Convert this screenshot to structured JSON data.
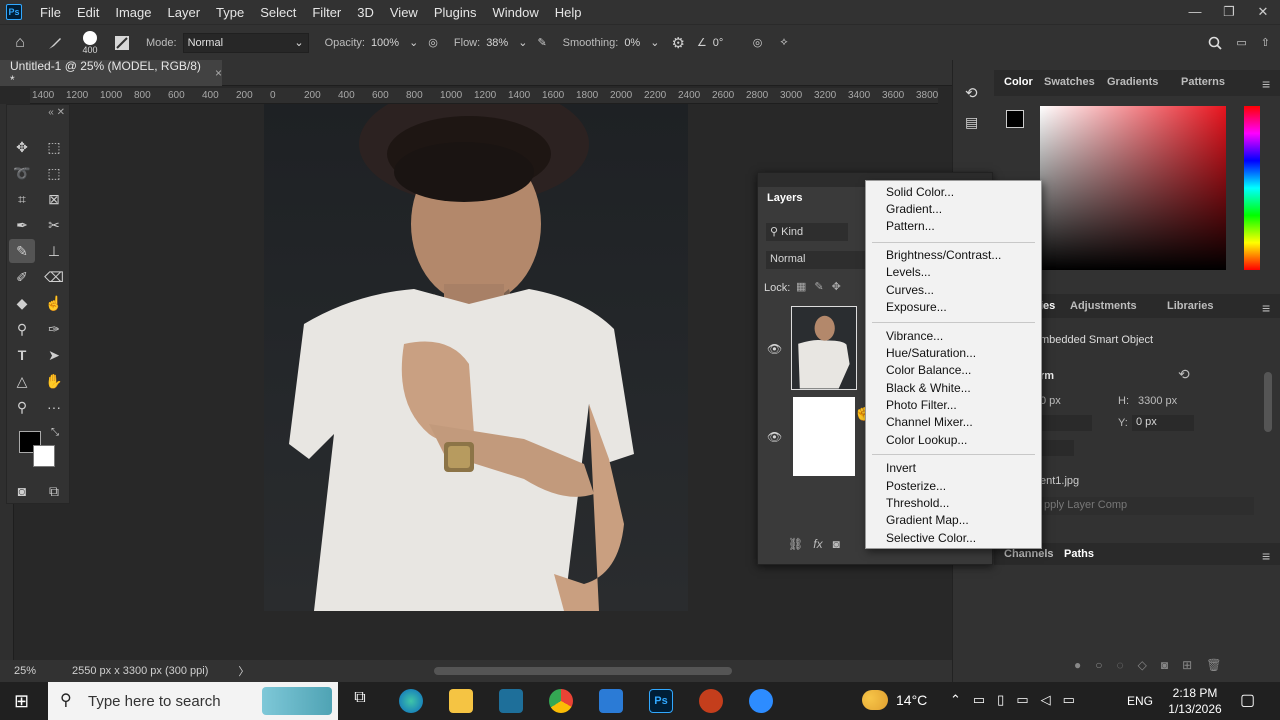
{
  "app": {
    "logo": "Ps",
    "menu": [
      "File",
      "Edit",
      "Image",
      "Layer",
      "Type",
      "Select",
      "Filter",
      "3D",
      "View",
      "Plugins",
      "Window",
      "Help"
    ],
    "window_controls": {
      "min": "—",
      "restore": "❐",
      "close": "✕"
    }
  },
  "options": {
    "brush_size": "400",
    "mode_label": "Mode:",
    "mode_value": "Normal",
    "opacity_label": "Opacity:",
    "opacity_value": "100%",
    "flow_label": "Flow:",
    "flow_value": "38%",
    "smoothing_label": "Smoothing:",
    "smoothing_value": "0%",
    "angle_value": "0°"
  },
  "document": {
    "tab_title": "Untitled-1 @ 25% (MODEL, RGB/8) *",
    "close": "×"
  },
  "ruler": {
    "ticks": [
      "1400",
      "1200",
      "1000",
      "800",
      "600",
      "400",
      "200",
      "0",
      "200",
      "400",
      "600",
      "800",
      "1000",
      "1200",
      "1400",
      "1600",
      "1800",
      "2000",
      "2200",
      "2400",
      "2600",
      "2800",
      "3000",
      "3200",
      "3400",
      "3600",
      "3800"
    ]
  },
  "status": {
    "zoom": "25%",
    "doc_info": "2550 px x 3300 px (300 ppi)",
    "arrow": "〉"
  },
  "right_panel": {
    "top_tabs": [
      "Color",
      "Swatches",
      "Gradients",
      "Patterns"
    ],
    "mid_tabs": [
      "Adjustments",
      "Libraries"
    ],
    "properties": {
      "partial_tab": "ies",
      "type": "mbedded Smart Object",
      "section": "rm",
      "w_value": "0 px",
      "h_label": "H:",
      "h_value": "3300 px",
      "y_label": "Y:",
      "y_value": "0 px",
      "file": "ent1.jpg",
      "apply_comp": "pply Layer Comp"
    },
    "bottom_tabs": [
      "Channels",
      "Paths"
    ]
  },
  "layers_panel": {
    "title": "Layers",
    "kind": "Kind",
    "blend": "Normal",
    "lock_label": "Lock:"
  },
  "adjustment_menu": {
    "groups": [
      [
        "Solid Color...",
        "Gradient...",
        "Pattern..."
      ],
      [
        "Brightness/Contrast...",
        "Levels...",
        "Curves...",
        "Exposure..."
      ],
      [
        "Vibrance...",
        "Hue/Saturation...",
        "Color Balance...",
        "Black & White...",
        "Photo Filter...",
        "Channel Mixer...",
        "Color Lookup..."
      ],
      [
        "Invert",
        "Posterize...",
        "Threshold...",
        "Gradient Map...",
        "Selective Color..."
      ]
    ]
  },
  "taskbar": {
    "search_placeholder": "Type here to search",
    "weather": "14°C",
    "language": "ENG",
    "time": "2:18 PM",
    "date": "1/13/2026"
  },
  "colors": {
    "accent": "#31a8ff",
    "panel": "#323232",
    "menu_bg": "#f2f2f2"
  }
}
